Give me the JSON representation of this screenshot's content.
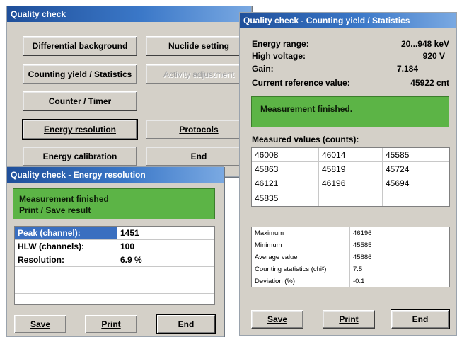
{
  "main_window": {
    "title": "Quality check",
    "buttons": {
      "differential_background": "Differential background",
      "nuclide_setting": "Nuclide setting",
      "counting_yield": "Counting yield / Statistics",
      "activity_adjustment": "Activity adjustment",
      "counter_timer": "Counter / Timer",
      "energy_resolution": "Energy resolution",
      "protocols": "Protocols",
      "energy_calibration": "Energy calibration",
      "end": "End"
    }
  },
  "energy_window": {
    "title": "Quality check - Energy resolution",
    "status_line1": "Measurement finished",
    "status_line2": "Print / Save result",
    "rows": [
      {
        "label": "Peak (channel):",
        "value": "1451"
      },
      {
        "label": "HLW (channels):",
        "value": "100"
      },
      {
        "label": "Resolution:",
        "value": "6.9 %"
      }
    ],
    "buttons": {
      "save": "Save",
      "print": "Print",
      "end": "End"
    }
  },
  "stats_window": {
    "title": "Quality check - Counting yield / Statistics",
    "info": [
      {
        "label": "Energy range:",
        "value": "20...948 keV"
      },
      {
        "label": "High voltage:",
        "value": "920 V"
      },
      {
        "label": "Gain:",
        "value": "7.184"
      },
      {
        "label": "Current reference value:",
        "value": "45922 cnt"
      }
    ],
    "status": "Measurement finished.",
    "measured_header": "Measured values (counts):",
    "measured": [
      [
        "46008",
        "46014",
        "45585"
      ],
      [
        "45863",
        "45819",
        "45724"
      ],
      [
        "46121",
        "46196",
        "45694"
      ],
      [
        "45835",
        "",
        ""
      ]
    ],
    "summary": [
      {
        "label": "Maximum",
        "value": "46196"
      },
      {
        "label": "Minimum",
        "value": "45585"
      },
      {
        "label": "Average value",
        "value": "45886"
      },
      {
        "label": "Counting statistics (chi²)",
        "value": "7.5"
      },
      {
        "label": "Deviation (%)",
        "value": "-0.1"
      }
    ],
    "buttons": {
      "save": "Save",
      "print": "Print",
      "end": "End"
    }
  },
  "colors": {
    "title_bar": "#1f4f9a",
    "status_green": "#5cb446",
    "selection": "#3a6fc0"
  }
}
